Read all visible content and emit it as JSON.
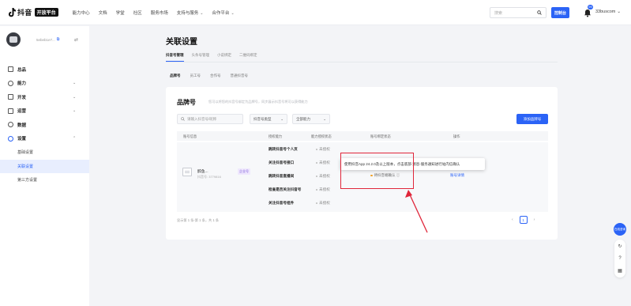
{
  "brand": {
    "name": "抖音",
    "badge": "开放平台"
  },
  "nav": {
    "items": [
      "能力中心",
      "文档",
      "学堂",
      "社区",
      "服务市场",
      "支持与服务",
      "合作平台"
    ]
  },
  "topbar": {
    "search_placeholder": "搜索",
    "console_label": "控制台",
    "notify_count": "99",
    "user_name": "33buscom"
  },
  "account": {
    "name": "5ebeb1e7..."
  },
  "sidebar": {
    "items": [
      {
        "label": "总品"
      },
      {
        "label": "能力"
      },
      {
        "label": "开发"
      },
      {
        "label": "运营"
      },
      {
        "label": "数据"
      },
      {
        "label": "设置"
      }
    ],
    "sub_items": [
      "基础设置",
      "关联设置",
      "第三方设置"
    ]
  },
  "page": {
    "title": "关联设置"
  },
  "tabs_main": [
    "抖音号管理",
    "头条号管理",
    "小说绑定",
    "二维码绑定"
  ],
  "tabs_sub": [
    "品牌号",
    "员工号",
    "合作号",
    "普通抖音号"
  ],
  "card": {
    "title": "品牌号",
    "desc": "您可以将您的抖音号绑定为品牌号，同步展示抖音号将可以获得能力",
    "search_placeholder": "请输入抖音号/昵称",
    "type_filter": "抖音号类型",
    "cap_filter": "全部能力",
    "add_label": "添加品牌号"
  },
  "table": {
    "headers": [
      "账号信息",
      "授权能力",
      "能力授权状态",
      "账号绑定状态",
      "操作"
    ],
    "account": {
      "name": "醉鱼...",
      "tag": "企业号",
      "id": "抖音号: 3779816"
    },
    "capabilities": [
      {
        "name": "跳转抖音号个人页",
        "status": "未授权"
      },
      {
        "name": "关注抖音号接口",
        "status": "未授权"
      },
      {
        "name": "跳转抖音直播间",
        "status": "未授权"
      },
      {
        "name": "检查是否关注抖音号",
        "status": "未授权"
      },
      {
        "name": "关注抖音号组件",
        "status": "未授权"
      }
    ],
    "bind_status": "待抖音端确认",
    "action": "账号详情",
    "footer": "显示第 1 条-第 1 条，共 1 条",
    "page": "1"
  },
  "tooltip": {
    "text": "使用抖音App 24.2.0及以上版本，点击底部-消息-服务通知进行站内信确认"
  },
  "float": {
    "top_label": "在线咨询"
  },
  "colors": {
    "accent": "#2b63f6",
    "highlight": "#e0263a",
    "pending": "#f2a022"
  }
}
